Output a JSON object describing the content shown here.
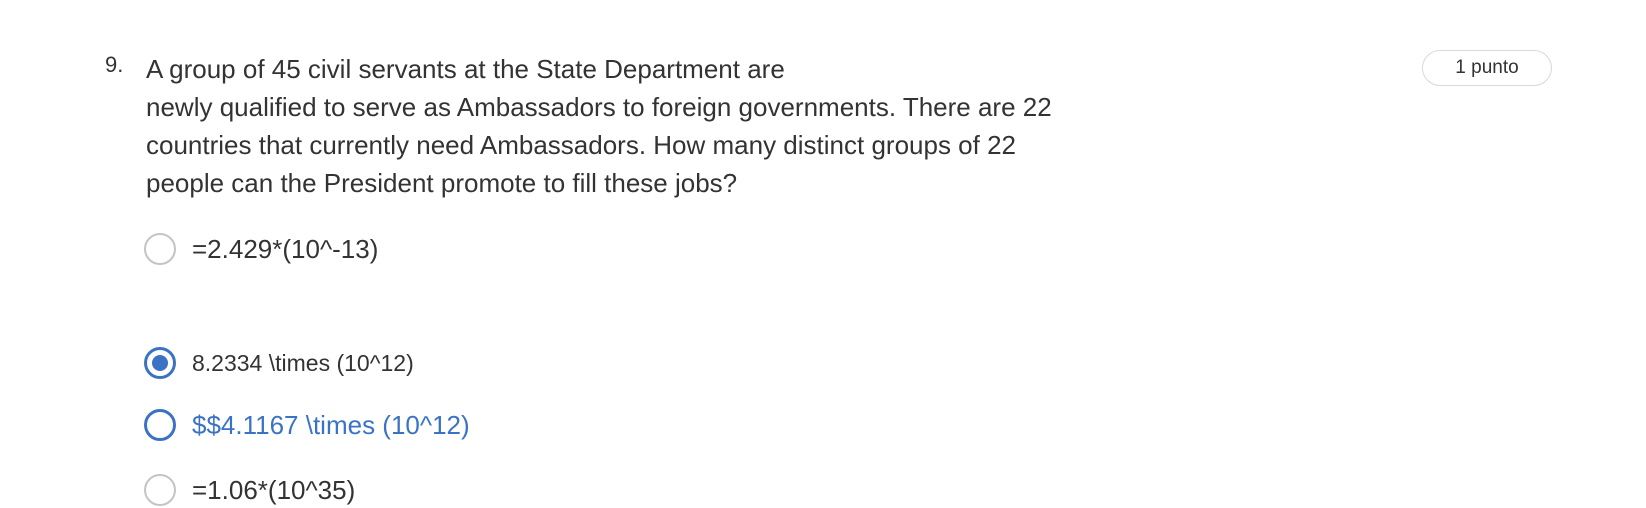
{
  "question": {
    "number": "9.",
    "text_lines": [
      "A group of 45 civil servants at the State Department are",
      "newly qualified to serve as Ambassadors to foreign governments. There are 22",
      "countries that currently need Ambassadors. How many distinct groups of 22",
      "people can the President promote to fill these jobs?"
    ],
    "points": "1 punto",
    "options": [
      {
        "label": "=2.429*(10^-13)",
        "selected": false
      },
      {
        "label": "8.2334 \\times (10^12)",
        "selected": true
      },
      {
        "label": "$$4.1167 \\times (10^12)",
        "selected": false,
        "highlighted": true
      },
      {
        "label": "=1.06*(10^35)",
        "selected": false
      }
    ]
  },
  "colors": {
    "accent": "#3b73c4",
    "text": "#333333",
    "radio_border": "#c4c4c4",
    "badge_border": "#d9d9d9"
  }
}
